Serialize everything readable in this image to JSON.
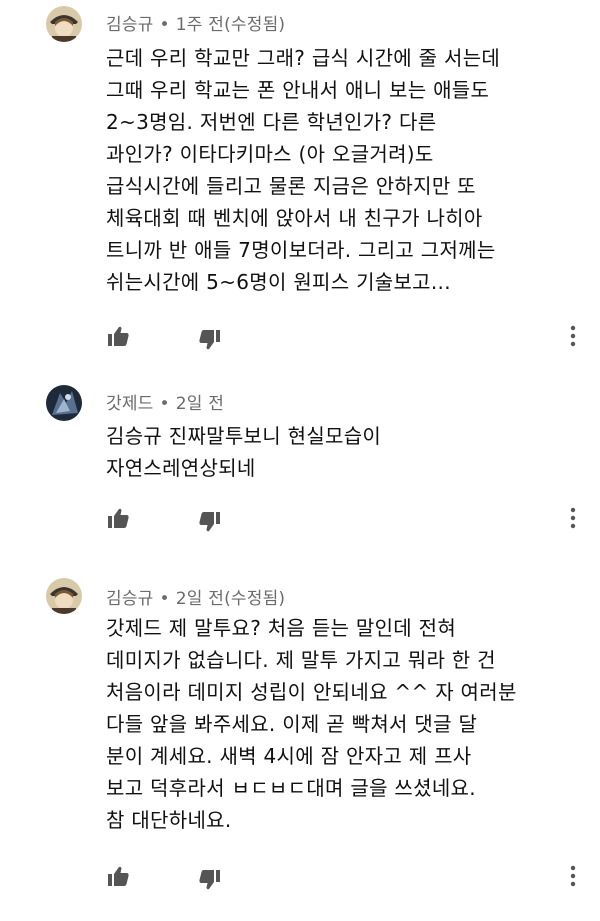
{
  "comments": [
    {
      "author": "김승규",
      "time": "1주 전(수정됨)",
      "lines": [
        "근데 우리 학교만 그래? 급식 시간에 줄 서는데",
        "그때 우리 학교는 폰 안내서 애니 보는 애들도",
        "2~3명임. 저번엔 다른 학년인가? 다른",
        "과인가? 이타다키마스 (아 오글거려)도",
        "급식시간에 들리고 물론 지금은 안하지만 또",
        "체육대회 때 벤치에 앉아서 내 친구가 나히아",
        "트니까 반 애들 7명이보더라. 그리고 그저께는",
        "쉬는시간에 5~6명이 원피스 기술보고..."
      ]
    },
    {
      "author": "갓제드",
      "time": "2일 전",
      "lines": [
        "김승규 진짜말투보니 현실모습이",
        "자연스레연상되네"
      ]
    },
    {
      "author": "김승규",
      "time": "2일 전(수정됨)",
      "lines": [
        "갓제드 제 말투요? 처음 듣는 말인데 전혀",
        "데미지가 없습니다. 제 말투 가지고 뭐라 한 건",
        "처음이라 데미지 성립이 안되네요 ^^ 자 여러분",
        "다들 앞을 봐주세요. 이제 곧 빡쳐서 댓글 달",
        "분이 계세요. 새벽 4시에 잠 안자고 제 프사",
        "보고 덕후라서 ㅂㄷㅂㄷ대며 글을 쓰셨네요.",
        "참 대단하네요."
      ]
    }
  ],
  "separator": "•",
  "colors": {
    "meta_text": "#6b6b6b",
    "body_text": "#111111",
    "icon": "#555555"
  }
}
